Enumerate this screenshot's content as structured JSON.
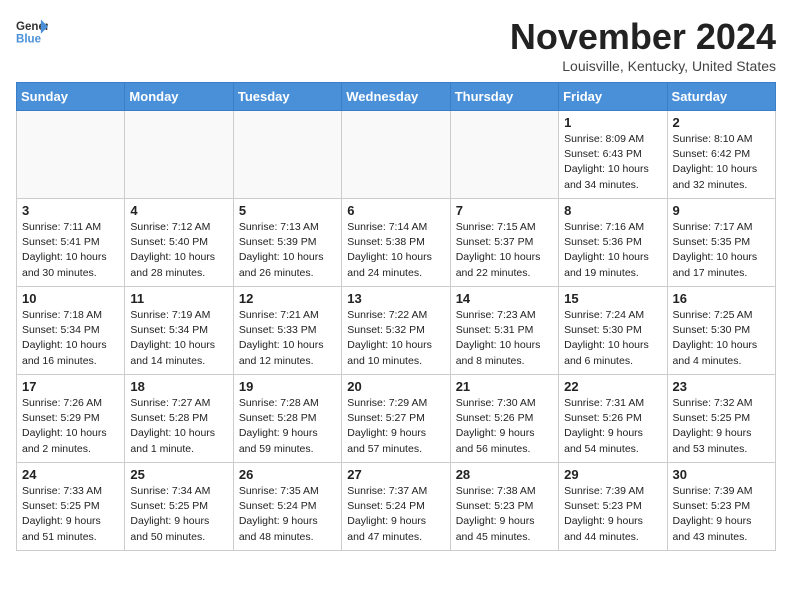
{
  "header": {
    "logo_line1": "General",
    "logo_line2": "Blue",
    "month": "November 2024",
    "location": "Louisville, Kentucky, United States"
  },
  "weekdays": [
    "Sunday",
    "Monday",
    "Tuesday",
    "Wednesday",
    "Thursday",
    "Friday",
    "Saturday"
  ],
  "weeks": [
    [
      {
        "day": "",
        "info": ""
      },
      {
        "day": "",
        "info": ""
      },
      {
        "day": "",
        "info": ""
      },
      {
        "day": "",
        "info": ""
      },
      {
        "day": "",
        "info": ""
      },
      {
        "day": "1",
        "info": "Sunrise: 8:09 AM\nSunset: 6:43 PM\nDaylight: 10 hours\nand 34 minutes."
      },
      {
        "day": "2",
        "info": "Sunrise: 8:10 AM\nSunset: 6:42 PM\nDaylight: 10 hours\nand 32 minutes."
      }
    ],
    [
      {
        "day": "3",
        "info": "Sunrise: 7:11 AM\nSunset: 5:41 PM\nDaylight: 10 hours\nand 30 minutes."
      },
      {
        "day": "4",
        "info": "Sunrise: 7:12 AM\nSunset: 5:40 PM\nDaylight: 10 hours\nand 28 minutes."
      },
      {
        "day": "5",
        "info": "Sunrise: 7:13 AM\nSunset: 5:39 PM\nDaylight: 10 hours\nand 26 minutes."
      },
      {
        "day": "6",
        "info": "Sunrise: 7:14 AM\nSunset: 5:38 PM\nDaylight: 10 hours\nand 24 minutes."
      },
      {
        "day": "7",
        "info": "Sunrise: 7:15 AM\nSunset: 5:37 PM\nDaylight: 10 hours\nand 22 minutes."
      },
      {
        "day": "8",
        "info": "Sunrise: 7:16 AM\nSunset: 5:36 PM\nDaylight: 10 hours\nand 19 minutes."
      },
      {
        "day": "9",
        "info": "Sunrise: 7:17 AM\nSunset: 5:35 PM\nDaylight: 10 hours\nand 17 minutes."
      }
    ],
    [
      {
        "day": "10",
        "info": "Sunrise: 7:18 AM\nSunset: 5:34 PM\nDaylight: 10 hours\nand 16 minutes."
      },
      {
        "day": "11",
        "info": "Sunrise: 7:19 AM\nSunset: 5:34 PM\nDaylight: 10 hours\nand 14 minutes."
      },
      {
        "day": "12",
        "info": "Sunrise: 7:21 AM\nSunset: 5:33 PM\nDaylight: 10 hours\nand 12 minutes."
      },
      {
        "day": "13",
        "info": "Sunrise: 7:22 AM\nSunset: 5:32 PM\nDaylight: 10 hours\nand 10 minutes."
      },
      {
        "day": "14",
        "info": "Sunrise: 7:23 AM\nSunset: 5:31 PM\nDaylight: 10 hours\nand 8 minutes."
      },
      {
        "day": "15",
        "info": "Sunrise: 7:24 AM\nSunset: 5:30 PM\nDaylight: 10 hours\nand 6 minutes."
      },
      {
        "day": "16",
        "info": "Sunrise: 7:25 AM\nSunset: 5:30 PM\nDaylight: 10 hours\nand 4 minutes."
      }
    ],
    [
      {
        "day": "17",
        "info": "Sunrise: 7:26 AM\nSunset: 5:29 PM\nDaylight: 10 hours\nand 2 minutes."
      },
      {
        "day": "18",
        "info": "Sunrise: 7:27 AM\nSunset: 5:28 PM\nDaylight: 10 hours\nand 1 minute."
      },
      {
        "day": "19",
        "info": "Sunrise: 7:28 AM\nSunset: 5:28 PM\nDaylight: 9 hours\nand 59 minutes."
      },
      {
        "day": "20",
        "info": "Sunrise: 7:29 AM\nSunset: 5:27 PM\nDaylight: 9 hours\nand 57 minutes."
      },
      {
        "day": "21",
        "info": "Sunrise: 7:30 AM\nSunset: 5:26 PM\nDaylight: 9 hours\nand 56 minutes."
      },
      {
        "day": "22",
        "info": "Sunrise: 7:31 AM\nSunset: 5:26 PM\nDaylight: 9 hours\nand 54 minutes."
      },
      {
        "day": "23",
        "info": "Sunrise: 7:32 AM\nSunset: 5:25 PM\nDaylight: 9 hours\nand 53 minutes."
      }
    ],
    [
      {
        "day": "24",
        "info": "Sunrise: 7:33 AM\nSunset: 5:25 PM\nDaylight: 9 hours\nand 51 minutes."
      },
      {
        "day": "25",
        "info": "Sunrise: 7:34 AM\nSunset: 5:25 PM\nDaylight: 9 hours\nand 50 minutes."
      },
      {
        "day": "26",
        "info": "Sunrise: 7:35 AM\nSunset: 5:24 PM\nDaylight: 9 hours\nand 48 minutes."
      },
      {
        "day": "27",
        "info": "Sunrise: 7:37 AM\nSunset: 5:24 PM\nDaylight: 9 hours\nand 47 minutes."
      },
      {
        "day": "28",
        "info": "Sunrise: 7:38 AM\nSunset: 5:23 PM\nDaylight: 9 hours\nand 45 minutes."
      },
      {
        "day": "29",
        "info": "Sunrise: 7:39 AM\nSunset: 5:23 PM\nDaylight: 9 hours\nand 44 minutes."
      },
      {
        "day": "30",
        "info": "Sunrise: 7:39 AM\nSunset: 5:23 PM\nDaylight: 9 hours\nand 43 minutes."
      }
    ]
  ]
}
